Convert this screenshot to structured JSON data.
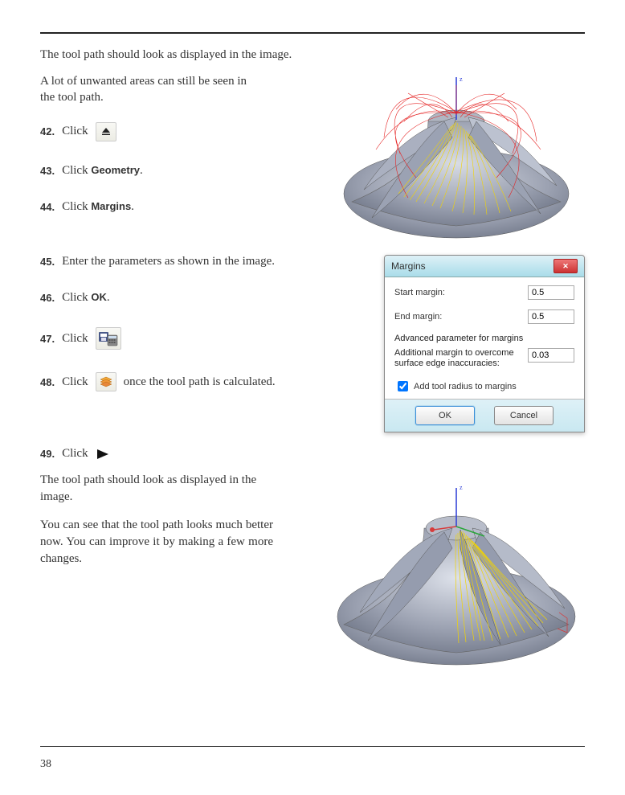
{
  "intro": "The tool path should look as displayed in the image.",
  "note1": "A lot of unwanted areas can still be seen in the tool path.",
  "steps": {
    "s42": {
      "num": "42.",
      "text": "Click"
    },
    "s43": {
      "num": "43.",
      "text": "Click ",
      "bold": "Geometry",
      "after": "."
    },
    "s44": {
      "num": "44.",
      "text": "Click ",
      "bold": "Margins",
      "after": "."
    },
    "s45": {
      "num": "45.",
      "text": "Enter the parameters as shown in the image."
    },
    "s46": {
      "num": "46.",
      "text": "Click ",
      "bold": "OK",
      "after": "."
    },
    "s47": {
      "num": "47.",
      "text": "Click"
    },
    "s48": {
      "num": "48.",
      "text1": "Click",
      "text2": "once the tool path is calculated."
    },
    "s49": {
      "num": "49.",
      "text": "Click"
    }
  },
  "dialog": {
    "title": "Margins",
    "start_label": "Start margin:",
    "start_value": "0.5",
    "end_label": "End margin:",
    "end_value": "0.5",
    "section": "Advanced parameter for margins",
    "adv_label": "Additional margin to overcome surface edge inaccuracies:",
    "adv_value": "0.03",
    "check_label": "Add tool radius to margins",
    "ok": "OK",
    "cancel": "Cancel"
  },
  "body2": "The tool path should look as displayed in the image.",
  "body3": "You can see that the tool path looks much better now. You can improve it by making a few more changes.",
  "page_number": "38"
}
